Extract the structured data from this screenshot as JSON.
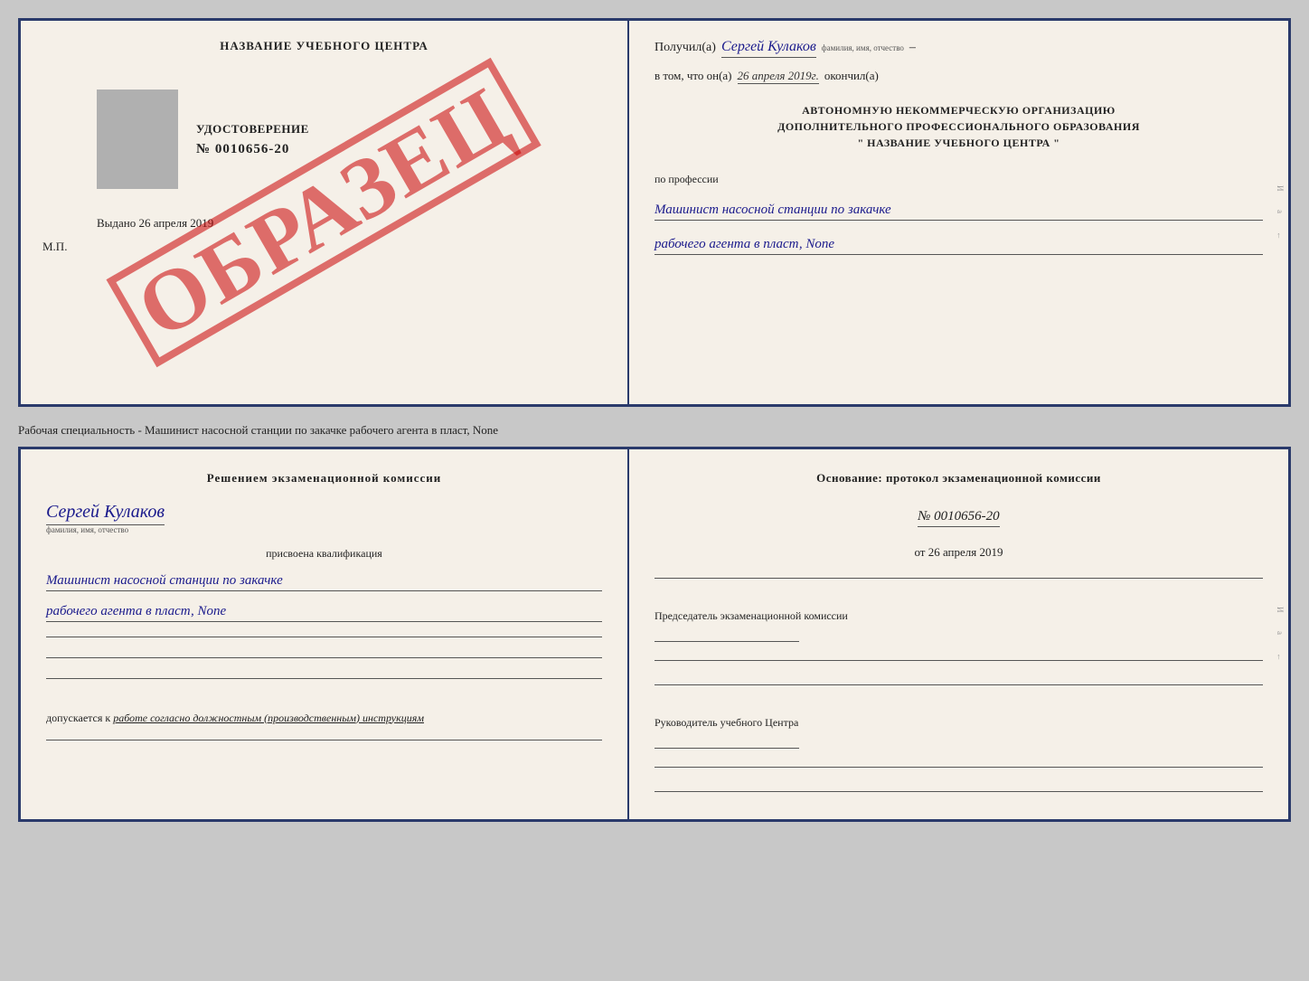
{
  "top_doc": {
    "left": {
      "title": "НАЗВАНИЕ УЧЕБНОГО ЦЕНТРА",
      "udostoverenie_label": "УДОСТОВЕРЕНИЕ",
      "number": "№ 0010656-20",
      "vydano_label": "Выдано",
      "vydano_date": "26 апреля 2019",
      "mp": "М.П.",
      "watermark": "ОБРАЗЕЦ"
    },
    "right": {
      "poluchil_label": "Получил(а)",
      "name": "Сергей Кулаков",
      "name_hint": "фамилия, имя, отчество",
      "vtom_label": "в том, что он(а)",
      "date": "26 апреля 2019г.",
      "okonchil_label": "окончил(а)",
      "org_line1": "АВТОНОМНУЮ НЕКОММЕРЧЕСКУЮ ОРГАНИЗАЦИЮ",
      "org_line2": "ДОПОЛНИТЕЛЬНОГО ПРОФЕССИОНАЛЬНОГО ОБРАЗОВАНИЯ",
      "org_line3": "\" НАЗВАНИЕ УЧЕБНОГО ЦЕНТРА \"",
      "po_professii": "по профессии",
      "profession_line1": "Машинист насосной станции по закачке",
      "profession_line2": "рабочего агента в пласт, None"
    }
  },
  "subtitle": "Рабочая специальность - Машинист насосной станции по закачке рабочего агента в пласт,\nNone",
  "bottom_doc": {
    "left": {
      "resheniem_label": "Решением экзаменационной комиссии",
      "name": "Сергей Кулаков",
      "name_hint": "фамилия, имя, отчество",
      "prisvoena_label": "присвоена квалификация",
      "profession_line1": "Машинист насосной станции по закачке",
      "profession_line2": "рабочего агента в пласт, None",
      "dopuskaetsya_label": "допускается к",
      "dopuskaetsya_value": "работе согласно должностным (производственным) инструкциям"
    },
    "right": {
      "osnovanie_label": "Основание: протокол экзаменационной комиссии",
      "protocol_num": "№ 0010656-20",
      "ot_label": "от",
      "ot_date": "26 апреля 2019",
      "chairman_label": "Председатель экзаменационной комиссии",
      "rukovoditel_label": "Руководитель учебного Центра"
    }
  }
}
